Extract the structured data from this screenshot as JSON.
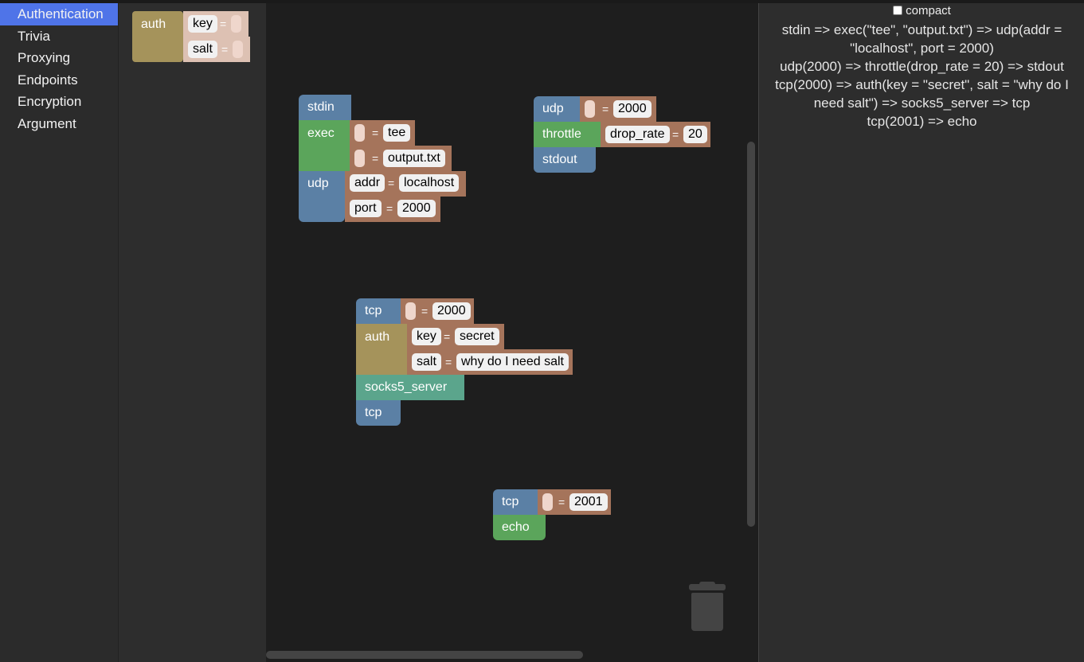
{
  "categories": [
    "Authentication",
    "Trivia",
    "Proxying",
    "Endpoints",
    "Encryption",
    "Argument"
  ],
  "active_category": "Authentication",
  "flyout": {
    "auth": {
      "name": "auth",
      "key": "key",
      "salt": "salt",
      "eq": "="
    }
  },
  "compact_label": "compact",
  "code_lines": [
    "stdin => exec(\"tee\", \"output.txt\") => udp(addr = \"localhost\", port = 2000)",
    "udp(2000) => throttle(drop_rate = 20) => stdout",
    "tcp(2000) => auth(key = \"secret\", salt = \"why do I need salt\") => socks5_server => tcp",
    "tcp(2001) => echo"
  ],
  "blocks": {
    "eq": "=",
    "chain1": {
      "stdin": "stdin",
      "exec": "exec",
      "exec_arg1": "tee",
      "exec_arg2": "output.txt",
      "udp": "udp",
      "addr_key": "addr",
      "addr_val": "localhost",
      "port_key": "port",
      "port_val": "2000"
    },
    "chain2": {
      "udp": "udp",
      "udp_val": "2000",
      "throttle": "throttle",
      "drop_key": "drop_rate",
      "drop_val": "20",
      "stdout": "stdout"
    },
    "chain3": {
      "tcp": "tcp",
      "tcp_val": "2000",
      "auth": "auth",
      "key_key": "key",
      "key_val": "secret",
      "salt_key": "salt",
      "salt_val": "why do I need salt",
      "socks": "socks5_server",
      "tcp2": "tcp"
    },
    "chain4": {
      "tcp": "tcp",
      "tcp_val": "2001",
      "echo": "echo"
    }
  }
}
